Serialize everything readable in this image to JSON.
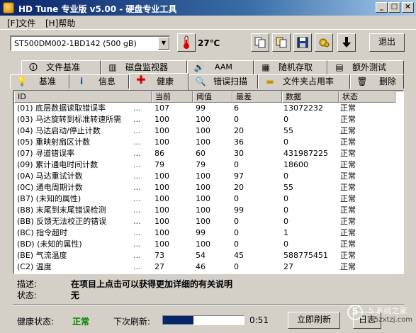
{
  "window": {
    "title": "HD Tune 专业版 v5.00 - 硬盘专业工具",
    "controls": {
      "minimize": "_",
      "maximize": "□",
      "close": "×"
    }
  },
  "menu": {
    "file": "[F]文件",
    "help": "[H]帮助"
  },
  "toolbar": {
    "drive": "ST500DM002-1BD142 (500 gB)",
    "temperature": "27℃",
    "exit_label": "退出",
    "icons": [
      "thermometer-icon",
      "copy-icon",
      "copy-all-icon",
      "save-icon",
      "settings-icon",
      "down-arrow-icon"
    ]
  },
  "tabs_top": [
    {
      "label": "文件基准",
      "icon": "info-icon"
    },
    {
      "label": "磁盘监视器",
      "icon": "chart-icon"
    },
    {
      "label": "AAM",
      "icon": "speaker-icon"
    },
    {
      "label": "随机存取",
      "icon": "random-icon"
    },
    {
      "label": "额外测试",
      "icon": "extra-test-icon"
    }
  ],
  "tabs_bottom": [
    {
      "label": "基准",
      "icon": "benchmark-icon"
    },
    {
      "label": "信息",
      "icon": "info-icon"
    },
    {
      "label": "健康",
      "icon": "health-cross-icon"
    },
    {
      "label": "错误扫描",
      "icon": "magnifier-icon"
    },
    {
      "label": "文件夹占用率",
      "icon": "folder-icon"
    },
    {
      "label": "删除",
      "icon": "trash-icon"
    }
  ],
  "table": {
    "columns": [
      "ID",
      "当前",
      "阈值",
      "最差",
      "数据",
      "状态"
    ],
    "rows": [
      {
        "attr": "(01) 底层数据读取错误率",
        "cur": "107",
        "thr": "99",
        "worst": "6",
        "data": "13072232",
        "status": "正常"
      },
      {
        "attr": "(03) 马达旋转到标准转速所需",
        "cur": "100",
        "thr": "100",
        "worst": "0",
        "data": "0",
        "status": "正常"
      },
      {
        "attr": "(04) 马达启动/停止计数",
        "cur": "100",
        "thr": "100",
        "worst": "20",
        "data": "55",
        "status": "正常"
      },
      {
        "attr": "(05) 重映射扇区计数",
        "cur": "100",
        "thr": "100",
        "worst": "36",
        "data": "0",
        "status": "正常"
      },
      {
        "attr": "(07) 寻道错误率",
        "cur": "86",
        "thr": "60",
        "worst": "30",
        "data": "431987225",
        "status": "正常"
      },
      {
        "attr": "(09) 累计通电时间计数",
        "cur": "79",
        "thr": "79",
        "worst": "0",
        "data": "18600",
        "status": "正常"
      },
      {
        "attr": "(0A) 马达重试计数",
        "cur": "100",
        "thr": "100",
        "worst": "97",
        "data": "0",
        "status": "正常"
      },
      {
        "attr": "(0C) 通电周期计数",
        "cur": "100",
        "thr": "100",
        "worst": "20",
        "data": "55",
        "status": "正常"
      },
      {
        "attr": "(B7) (未知的属性)",
        "cur": "100",
        "thr": "100",
        "worst": "0",
        "data": "0",
        "status": "正常"
      },
      {
        "attr": "(B8) 末尾到末尾错误检测",
        "cur": "100",
        "thr": "100",
        "worst": "99",
        "data": "0",
        "status": "正常"
      },
      {
        "attr": "(BB) 反馈无法校正的错误",
        "cur": "100",
        "thr": "100",
        "worst": "0",
        "data": "0",
        "status": "正常"
      },
      {
        "attr": "(BC) 指令超时",
        "cur": "100",
        "thr": "99",
        "worst": "0",
        "data": "1",
        "status": "正常"
      },
      {
        "attr": "(BD) (未知的属性)",
        "cur": "100",
        "thr": "100",
        "worst": "0",
        "data": "0",
        "status": "正常"
      },
      {
        "attr": "(BE) 气流温度",
        "cur": "73",
        "thr": "54",
        "worst": "45",
        "data": "588775451",
        "status": "正常"
      },
      {
        "attr": "(C2) 温度",
        "cur": "27",
        "thr": "46",
        "worst": "0",
        "data": "27",
        "status": "正常"
      }
    ]
  },
  "description": {
    "label": "描述:",
    "value": "在项目上点击可以获得更加详细的有关说明",
    "status_label": "状态:",
    "status_value": "无"
  },
  "statusbar": {
    "health_label": "健康状态:",
    "health_value": "正常",
    "refresh_label": "下次刷新:",
    "progress_fraction": 0.38,
    "timer": "0:51",
    "refresh_now": "立即刷新",
    "log_label": "日志"
  },
  "watermark": {
    "glyph": "5",
    "text": "5 系统之家",
    "site": "5zxtzj.com"
  },
  "colors": {
    "title_start": "#0a246a",
    "title_end": "#a6caf0",
    "health_ok": "#008000",
    "window_bg": "#d4d0c8"
  }
}
